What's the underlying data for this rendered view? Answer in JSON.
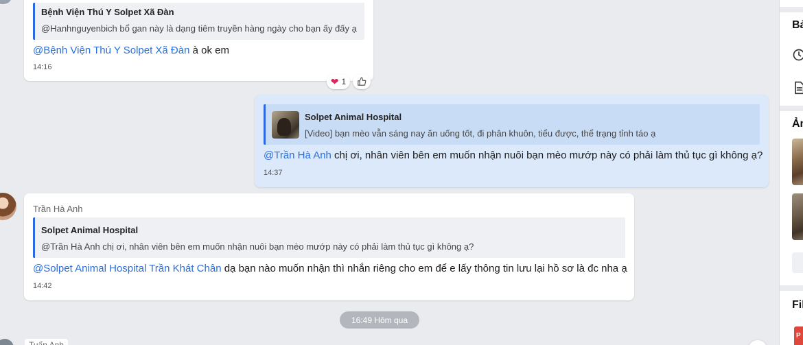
{
  "messages": [
    {
      "quote_title": "Bệnh Viện Thú Y Solpet Xã Đàn",
      "quote_text": "@Hanhnguyenbich bổ gan này là dạng tiêm truyền hàng ngày cho bạn ấy đấy ạ",
      "mention": "@Bệnh Viện Thú Y Solpet Xã Đàn",
      "text": " à ok em",
      "time": "14:16",
      "reaction_count": "1"
    },
    {
      "quote_title": "Solpet Animal Hospital",
      "quote_text": "[Video] bạn mèo vẫn sáng nay ăn uống tốt, đi phân khuôn, tiểu được, thể trạng tỉnh táo ạ",
      "mention": "@Trần Hà Anh",
      "text": " chị ơi, nhân viên bên em muốn nhận nuôi bạn mèo mướp này có phải làm thủ tục gì không ạ?",
      "time": "14:37"
    },
    {
      "sender": "Trần Hà Anh",
      "quote_title": "Solpet Animal Hospital",
      "quote_text": "@Trần Hà Anh chị ơi, nhân viên bên em muốn nhận nuôi bạn mèo mướp này có phải làm thủ tục gì không ạ?",
      "mention": "@Solpet Animal Hospital Trần Khát Chân",
      "text": " dạ bạn nào muốn nhận thì nhắn riêng cho em để e lấy thông tin lưu lại hồ sơ là đc nha ạ",
      "time": "14:42"
    }
  ],
  "date_divider": "16:49 Hôm qua",
  "next_sender": "Tuấn Anh",
  "right_panel": {
    "section1_title": "Bả",
    "section2_title": "Ản",
    "section3_title": "Fil",
    "file_badge": "P"
  },
  "colors": {
    "mention": "#2a6fdb",
    "self_bubble": "#dbe9fb",
    "quote_bar": "#2b67e0",
    "background": "#e9ebee"
  },
  "icons": [
    "heart-icon",
    "thumbs-up-icon",
    "clock-icon",
    "document-icon"
  ]
}
